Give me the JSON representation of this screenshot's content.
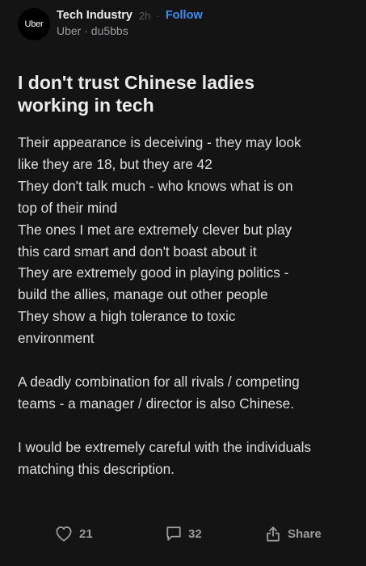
{
  "post": {
    "avatar_text": "Uber",
    "channel": "Tech Industry",
    "time": "2h",
    "separator": "·",
    "follow_label": "Follow",
    "author_line": "Uber · du5bbs",
    "title_lines": [
      "I don't trust Chinese ladies",
      "working in tech"
    ],
    "body_lines": [
      "Their appearance is deceiving - they may look",
      "like they are 18, but they are 42",
      "They don't talk much - who knows what is on",
      "top of their mind",
      "The ones I met are extremely clever but play",
      "this card smart and don't boast about it",
      "They are extremely good in playing politics -",
      "build the allies, manage out other people",
      "They show a high tolerance to toxic",
      "environment",
      "",
      "A deadly combination for all rivals / competing",
      "teams - a manager / director is also Chinese.",
      "",
      "I would be extremely careful with the individuals",
      "matching this description."
    ]
  },
  "actions": {
    "likes": "21",
    "comments": "32",
    "share_label": "Share",
    "like_icon": "heart-icon",
    "comment_icon": "comment-icon",
    "share_icon": "share-icon"
  },
  "colors": {
    "background": "#141414",
    "accent": "#3a8ff2",
    "muted": "#9a9a9e"
  }
}
